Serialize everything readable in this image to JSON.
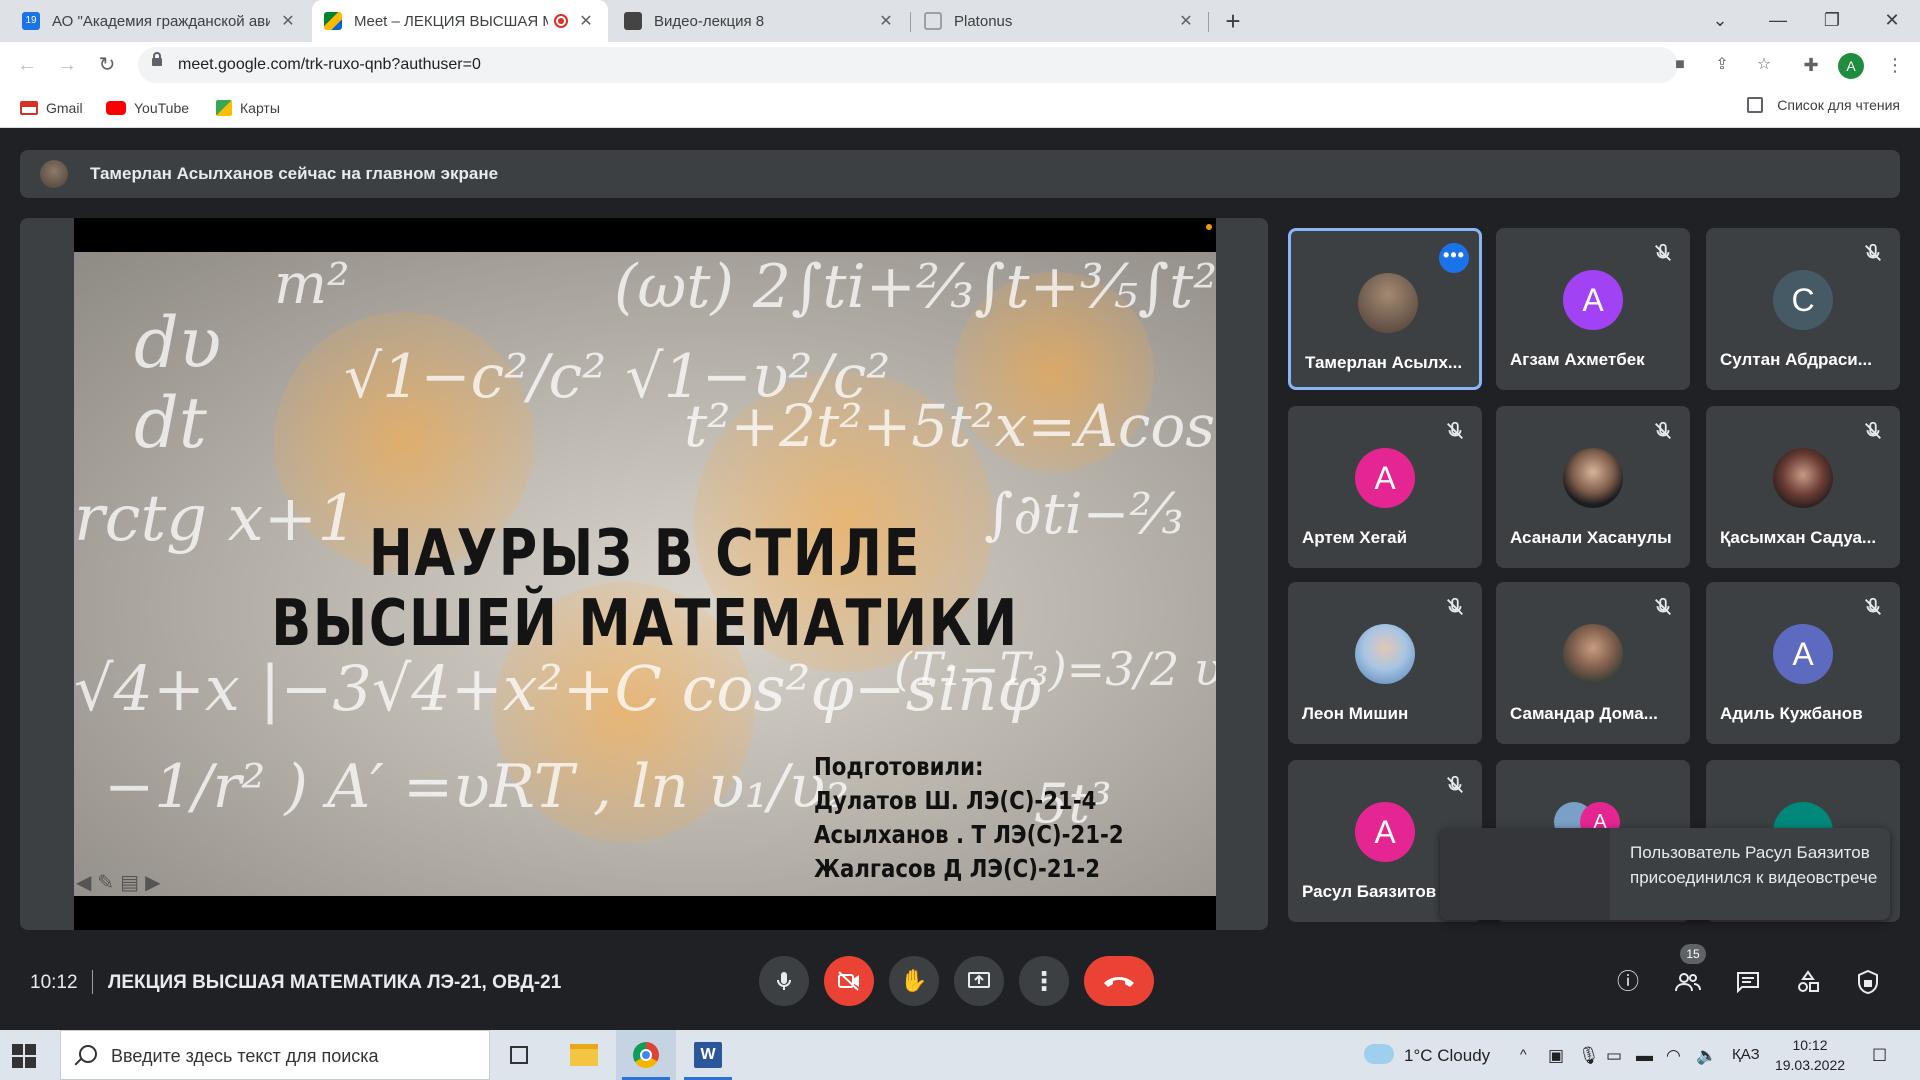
{
  "browser": {
    "tabs": [
      {
        "title": "АО \"Академия гражданской ави",
        "active": false
      },
      {
        "title": "Meet – ЛЕКЦИЯ ВЫСШАЯ М",
        "active": true
      },
      {
        "title": "Видео-лекция 8",
        "active": false
      },
      {
        "title": "Platonus",
        "active": false
      }
    ],
    "url": "meet.google.com/trk-ruxo-qnb?authuser=0",
    "profile_initial": "A",
    "bookmarks": [
      "Gmail",
      "YouTube",
      "Карты"
    ],
    "reading_list": "Список для чтения"
  },
  "meet": {
    "banner_text": "Тамерлан Асылханов сейчас на главном экране",
    "slide": {
      "title_line1": "Наурыз в стиле",
      "title_line2": "высшей математики",
      "credits_head": "Подготовили:",
      "credits": [
        "Дулатов Ш. ЛЭ(С)-21-4",
        "Асылханов . Т ЛЭ(С)-21-2",
        "Жалгасов Д ЛЭ(С)-21-2"
      ]
    },
    "participants": [
      {
        "name": "Тамерлан Асылх...",
        "initial": "",
        "color": "#6b5a4d",
        "speaking": true
      },
      {
        "name": "Агзам Ахметбек",
        "initial": "A",
        "color": "#a142f4",
        "speaking": false
      },
      {
        "name": "Султан Абдраси...",
        "initial": "C",
        "color": "#455a64",
        "speaking": false
      },
      {
        "name": "Артем Хегай",
        "initial": "A",
        "color": "#e52592",
        "speaking": false
      },
      {
        "name": "Асанали Хасанулы",
        "initial": "",
        "color": "#2d2f33",
        "speaking": false
      },
      {
        "name": "Қасымхан Садуа...",
        "initial": "",
        "color": "#5a3a33",
        "speaking": false
      },
      {
        "name": "Леон Мишин",
        "initial": "",
        "color": "#9cc3e6",
        "speaking": false
      },
      {
        "name": "Самандар Дома...",
        "initial": "",
        "color": "#6d5a4e",
        "speaking": false
      },
      {
        "name": "Адиль Кужбанов",
        "initial": "A",
        "color": "#5c6bc0",
        "speaking": false
      },
      {
        "name": "Расул Баязитов",
        "initial": "A",
        "color": "#e52592",
        "speaking": false
      }
    ],
    "toast": "Пользователь Расул Баязитов присоединился к видеовстрече",
    "time": "10:12",
    "meeting_title": "ЛЕКЦИЯ ВЫСШАЯ МАТЕМАТИКА ЛЭ-21, ОВД-21",
    "participant_count": "15"
  },
  "taskbar": {
    "search_placeholder": "Введите здесь текст для поиска",
    "weather": "1°C  Cloudy",
    "lang": "ҚАЗ",
    "time": "10:12",
    "date": "19.03.2022"
  }
}
